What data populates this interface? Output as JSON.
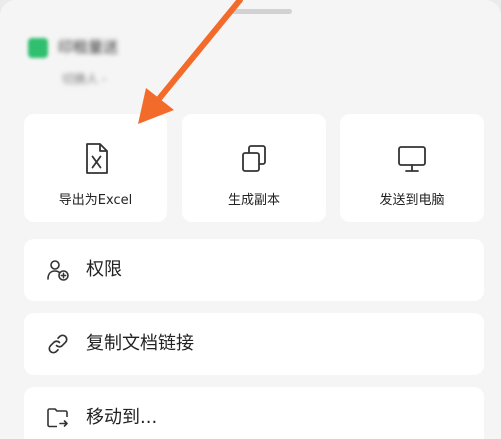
{
  "document": {
    "title": "印租量送",
    "subtitle": "切换人 -"
  },
  "actions": {
    "export_excel": {
      "label": "导出为Excel",
      "icon": "excel-file-icon"
    },
    "make_copy": {
      "label": "生成副本",
      "icon": "copy-icon"
    },
    "send_to_pc": {
      "label": "发送到电脑",
      "icon": "monitor-icon"
    }
  },
  "menu": {
    "permissions": {
      "label": "权限",
      "icon": "add-user-icon"
    },
    "copy_link": {
      "label": "复制文档链接",
      "icon": "link-icon"
    },
    "move_to": {
      "label": "移动到...",
      "icon": "move-folder-icon"
    }
  },
  "colors": {
    "annotation_arrow": "#f26b2a",
    "doc_icon": "#2fbf6e",
    "card_bg": "#ffffff",
    "sheet_bg": "#f5f5f5"
  }
}
